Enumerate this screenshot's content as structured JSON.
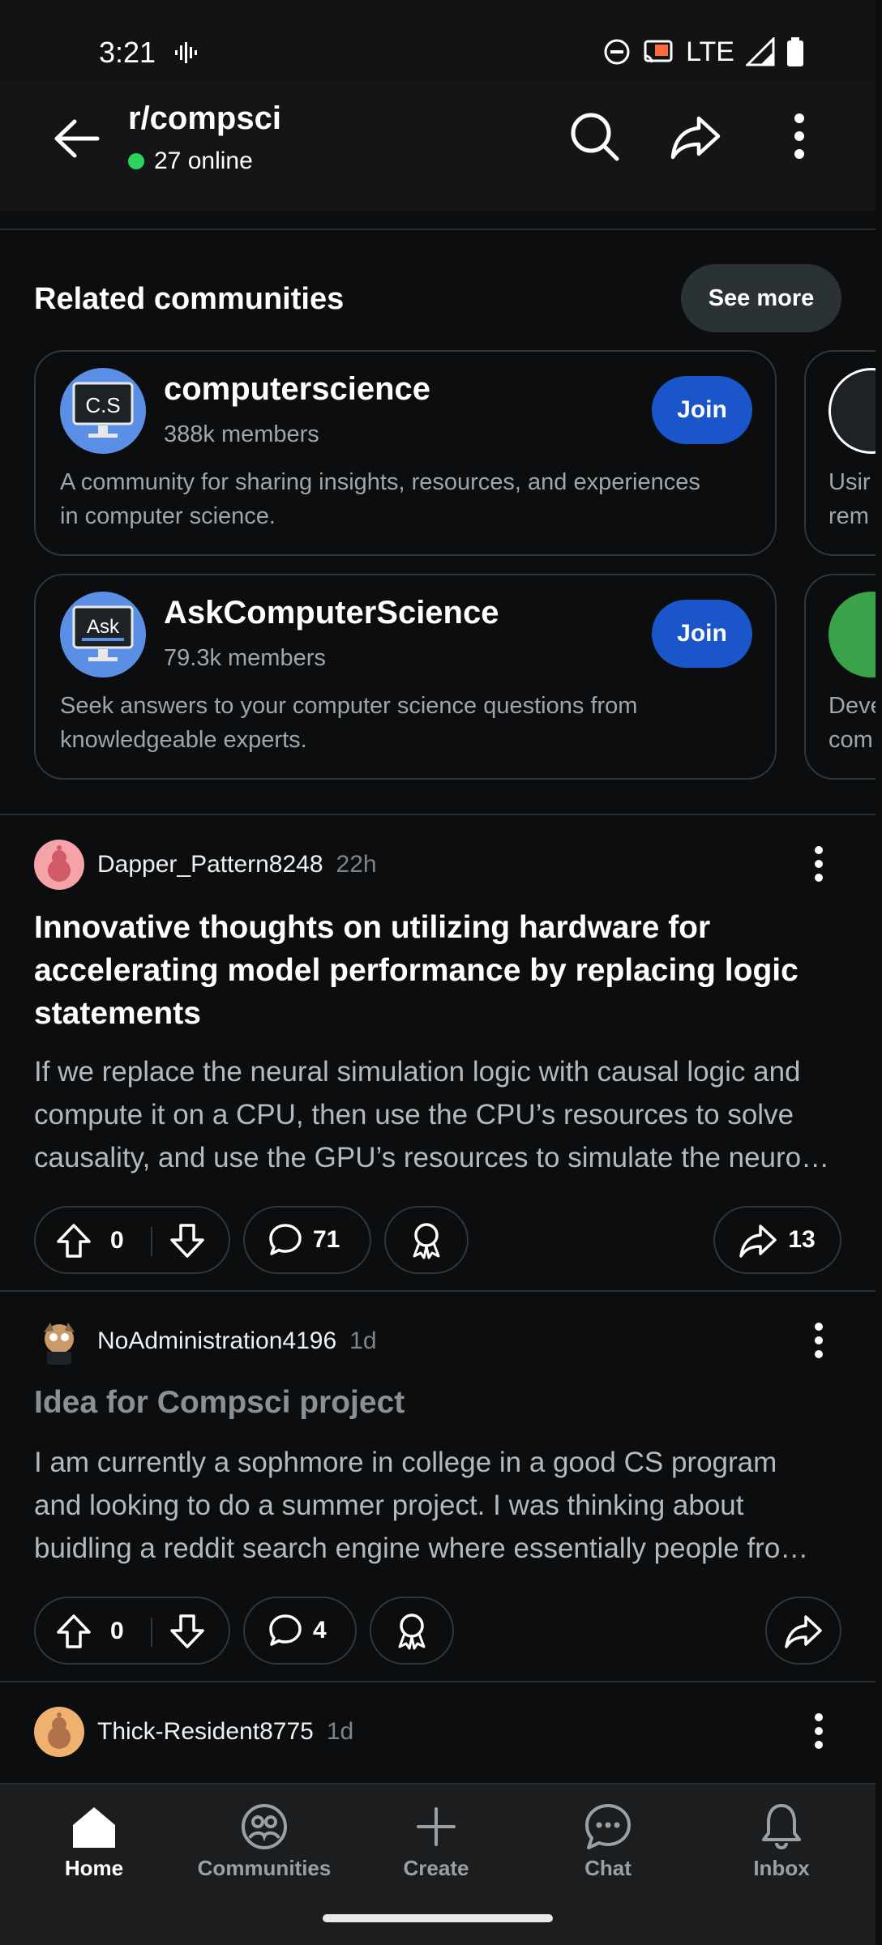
{
  "status_bar": {
    "time": "3:21",
    "network": "LTE"
  },
  "header": {
    "subreddit": "r/compsci",
    "online": "27 online"
  },
  "related": {
    "title": "Related communities",
    "see_more": "See more",
    "communities": [
      {
        "name": "computerscience",
        "members": "388k members",
        "description_lines": [
          "A community for sharing insights, resources, and experiences",
          "in computer science."
        ],
        "join": "Join",
        "avatar_text": "C.S"
      },
      {
        "name": "AskComputerScience",
        "members": "79.3k members",
        "description_lines": [
          "Seek answers to your computer science questions from",
          "knowledgeable experts."
        ],
        "join": "Join",
        "avatar_text": "Ask"
      }
    ],
    "peek_cards": [
      {
        "text_lines": [
          "Usir",
          "rem"
        ]
      },
      {
        "text_lines": [
          "Deve",
          "com"
        ]
      }
    ]
  },
  "posts": [
    {
      "author": "Dapper_Pattern8248",
      "age": "22h",
      "title_lines": [
        "Innovative thoughts on utilizing hardware for",
        "accelerating model performance by replacing logic",
        "statements"
      ],
      "body_lines": [
        "If we replace the neural simulation logic with causal logic and",
        "compute it on a CPU, then use the CPU’s resources to solve",
        "causality, and use the GPU’s resources to simulate the neuro…"
      ],
      "score": "0",
      "comments": "71",
      "shares": "13"
    },
    {
      "author": "NoAdministration4196",
      "age": "1d",
      "title_lines": [
        "Idea for Compsci project"
      ],
      "body_lines": [
        "I am currently a sophmore in college in a good CS program",
        "and looking to do a summer project. I was thinking about",
        "buidling a reddit search engine where essentially people fro…"
      ],
      "score": "0",
      "comments": "4"
    },
    {
      "author": "Thick-Resident8775",
      "age": "1d"
    }
  ],
  "bottom_nav": [
    {
      "label": "Home",
      "icon": "home-icon",
      "active": true
    },
    {
      "label": "Communities",
      "icon": "communities-icon",
      "active": false
    },
    {
      "label": "Create",
      "icon": "plus-icon",
      "active": false
    },
    {
      "label": "Chat",
      "icon": "chat-icon",
      "active": false
    },
    {
      "label": "Inbox",
      "icon": "bell-icon",
      "active": false
    }
  ],
  "colors": {
    "background": "#0b0d0e",
    "join": "#1a56c9",
    "online": "#2bd458",
    "card_border": "#30373b"
  }
}
